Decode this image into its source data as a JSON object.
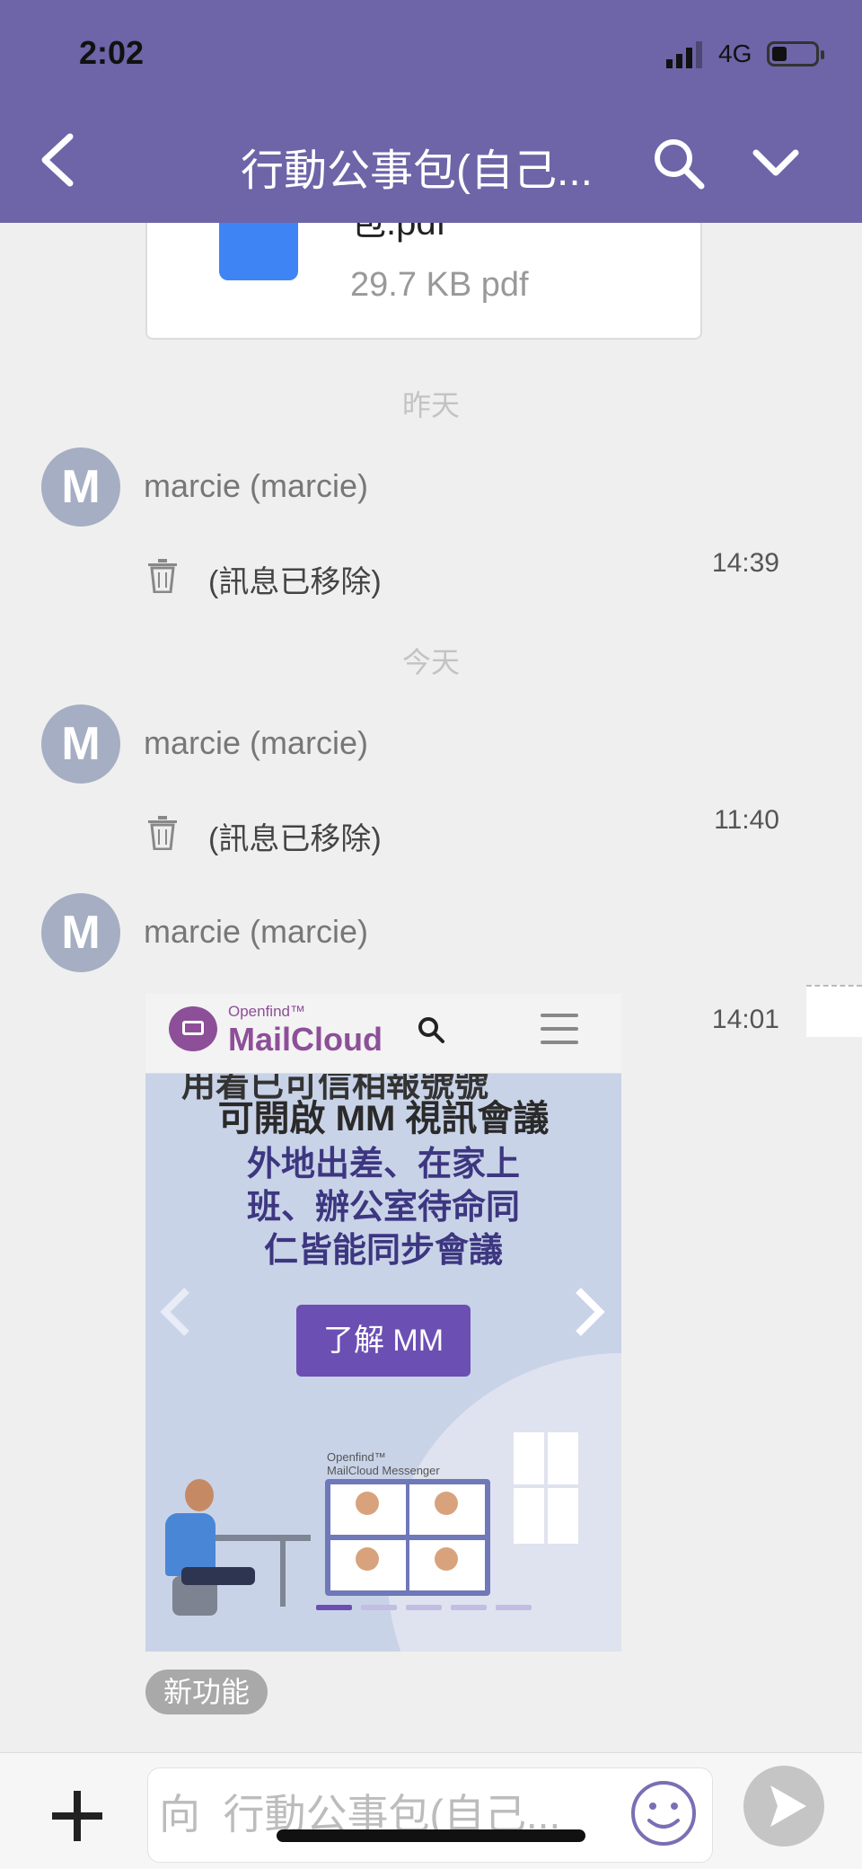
{
  "status_bar": {
    "time": "2:02",
    "network": "4G",
    "battery_level": 0.3
  },
  "header": {
    "title": "行動公事包(自己..."
  },
  "file_attachment": {
    "name": "包.pdf",
    "meta": "29.7 KB pdf",
    "icon": "file-icon",
    "accent": "#3f84f5"
  },
  "messages": [
    {
      "date_label": "昨天",
      "sender": "marcie (marcie)",
      "avatar_letter": "M",
      "text": "(訊息已移除)",
      "time": "14:39"
    },
    {
      "date_label": "今天",
      "sender": "marcie (marcie)",
      "avatar_letter": "M",
      "text": "(訊息已移除)",
      "time": "11:40"
    },
    {
      "sender": "marcie (marcie)",
      "avatar_letter": "M",
      "time": "14:01"
    }
  ],
  "ad_image": {
    "brand_small": "Openfind™",
    "brand": "MailCloud",
    "cut_text": "用着已可信相報號號",
    "line1": "可開啟 MM 視訊會議",
    "body_lines": [
      "外地出差、在家上",
      "班、辦公室待命同",
      "仁皆能同步會議"
    ],
    "button_label": "了解 MM",
    "mini_small": "Openfind™",
    "mini_label": "MailCloud Messenger"
  },
  "badge": "新功能",
  "compose": {
    "placeholder": "向  行動公事包(自己..."
  },
  "colors": {
    "header": "#6e64a8",
    "avatar": "#a5aec2",
    "ad_button": "#6c4fb3"
  }
}
